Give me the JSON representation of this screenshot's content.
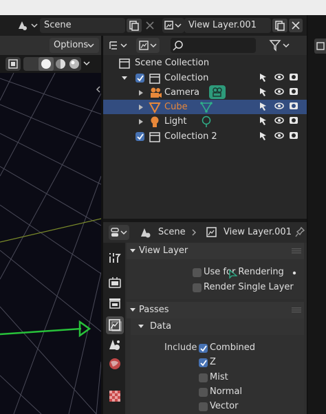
{
  "window": {
    "scene_label": "Scene",
    "view_layer_label": "View Layer.001"
  },
  "viewport": {
    "options_label": "Options"
  },
  "outliner": {
    "root_label": "Scene Collection",
    "items": [
      {
        "label": "Collection",
        "selected": false
      },
      {
        "label": "Camera",
        "selected": false
      },
      {
        "label": "Cube",
        "selected": true
      },
      {
        "label": "Light",
        "selected": false
      },
      {
        "label": "Collection 2",
        "selected": false
      }
    ]
  },
  "properties": {
    "scene_label": "Scene",
    "view_layer_label": "View Layer.001",
    "view_layer_panel": {
      "title": "View Layer",
      "use_for_rendering": {
        "label": "Use for Rendering",
        "checked": false
      },
      "render_single_layer": {
        "label": "Render Single Layer",
        "checked": false
      }
    },
    "passes_panel": {
      "title": "Passes",
      "data_subpanel": {
        "title": "Data",
        "include_label": "Include",
        "passes": [
          {
            "label": "Combined",
            "checked": true
          },
          {
            "label": "Z",
            "checked": true
          },
          {
            "label": "Mist",
            "checked": false
          },
          {
            "label": "Normal",
            "checked": false
          },
          {
            "label": "Vector",
            "checked": false
          }
        ]
      }
    }
  },
  "colors": {
    "selection": "#334d80",
    "checkbox_on": "#4772b3",
    "cube_orange": "#e8883a",
    "green_teal": "#2fb08a",
    "grid_line": "#4a4a58",
    "axis_green": "#28c23a"
  }
}
